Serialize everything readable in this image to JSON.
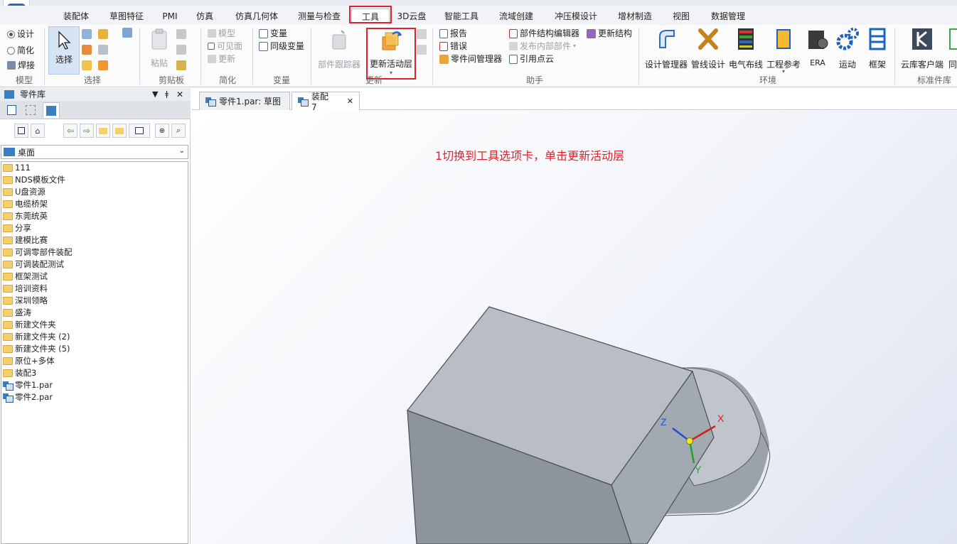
{
  "ribbon": {
    "tabs": [
      "装配体",
      "草图特征",
      "PMI",
      "仿真",
      "仿真几何体",
      "测量与检查",
      "工具",
      "3D云盘",
      "智能工具",
      "流域创建",
      "冲压模设计",
      "增材制造",
      "视图",
      "数据管理"
    ],
    "active_tab": "工具",
    "mode": {
      "design": "设计",
      "simplify": "简化",
      "weld": "焊接",
      "group": "模型"
    },
    "select": {
      "label": "选择",
      "group": "选择"
    },
    "clipboard": {
      "paste": "粘贴",
      "group": "剪贴板"
    },
    "simplify": {
      "model": "模型",
      "visible_faces": "可见面",
      "update": "更新",
      "group": "简化"
    },
    "variables": {
      "variable": "变量",
      "sync_variable": "同级变量",
      "group": "变量"
    },
    "update": {
      "part_tracker": "部件跟踪器",
      "update_active_layer": "更新活动层",
      "group": "更新"
    },
    "assistant": {
      "report": "报告",
      "errors": "错误",
      "inter_part_manager": "零件间管理器",
      "structure_editor": "部件结构编辑器",
      "publish_internal": "发布内部部件",
      "reference_point_cloud": "引用点云",
      "update_structure": "更新结构",
      "group": "助手"
    },
    "environment": {
      "items": [
        "设计管理器",
        "管线设计",
        "电气布线",
        "工程参考",
        "ERA",
        "运动",
        "框架"
      ],
      "group": "环境"
    },
    "standard_parts": {
      "cloud_client": "云库客户端",
      "partial": "同",
      "group": "标准件库"
    }
  },
  "left_panel": {
    "title": "零件库",
    "location": "桌面",
    "items": [
      {
        "name": "111",
        "type": "folder"
      },
      {
        "name": "NDS模板文件",
        "type": "folder"
      },
      {
        "name": "U盘资源",
        "type": "folder"
      },
      {
        "name": "电缆桥架",
        "type": "folder"
      },
      {
        "name": "东莞统英",
        "type": "folder"
      },
      {
        "name": "分享",
        "type": "folder"
      },
      {
        "name": "建模比赛",
        "type": "folder"
      },
      {
        "name": "可调零部件装配",
        "type": "folder"
      },
      {
        "name": "可调装配测试",
        "type": "folder"
      },
      {
        "name": "框架测试",
        "type": "folder"
      },
      {
        "name": "培训资料",
        "type": "folder"
      },
      {
        "name": "深圳领略",
        "type": "folder"
      },
      {
        "name": "盛涛",
        "type": "folder"
      },
      {
        "name": "新建文件夹",
        "type": "folder"
      },
      {
        "name": "新建文件夹 (2)",
        "type": "folder"
      },
      {
        "name": "新建文件夹 (5)",
        "type": "folder"
      },
      {
        "name": "原位+多体",
        "type": "folder"
      },
      {
        "name": "装配3",
        "type": "folder"
      },
      {
        "name": "零件1.par",
        "type": "part"
      },
      {
        "name": "零件2.par",
        "type": "part"
      }
    ]
  },
  "doc_tabs": [
    {
      "label": "零件1.par: 草图",
      "active": false
    },
    {
      "label": "装配7",
      "active": true
    }
  ],
  "viewport": {
    "annotation": "1切换到工具选项卡，单击更新活动层",
    "axes": {
      "x": "X",
      "y": "Y",
      "z": "Z"
    }
  },
  "colors": {
    "highlight": "#e0202a",
    "block_top": "#b9bec5",
    "block_front": "#8e949c",
    "block_side": "#a3a9b1",
    "cylinder": "#c0c5cc"
  }
}
